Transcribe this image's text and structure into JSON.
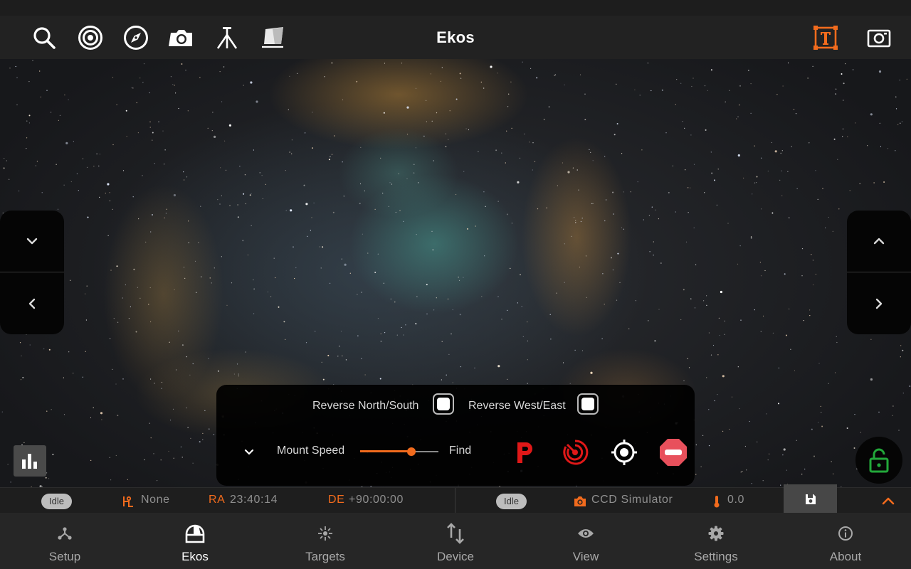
{
  "app": {
    "title": "Ekos"
  },
  "toolbar": {
    "left_icons": [
      "search-icon",
      "target-icon",
      "compass-icon",
      "camera-icon",
      "tripod-icon",
      "flat-panel-icon"
    ],
    "right_icons": [
      "text-frame-icon",
      "capture-frame-icon"
    ],
    "accent": "#f26b1d"
  },
  "mount_panel": {
    "reverse_ns_label": "Reverse North/South",
    "reverse_we_label": "Reverse West/East",
    "speed_label": "Mount Speed",
    "speed_value_label": "Find",
    "speed_fraction": 0.65,
    "actions": [
      "park-icon",
      "tracking-icon",
      "goto-target-icon",
      "stop-icon"
    ]
  },
  "status": {
    "mount_state": "Idle",
    "pier_side": "None",
    "ra_label": "RA",
    "ra_value": "23:40:14",
    "de_label": "DE",
    "de_value": "+90:00:00",
    "camera_state": "Idle",
    "camera_name": "CCD Simulator",
    "temperature": "0.0"
  },
  "nav": [
    {
      "label": "Setup",
      "icon": "setup-icon",
      "active": false
    },
    {
      "label": "Ekos",
      "icon": "ekos-dome-icon",
      "active": true
    },
    {
      "label": "Targets",
      "icon": "targets-icon",
      "active": false
    },
    {
      "label": "Device",
      "icon": "device-arrows-icon",
      "active": false
    },
    {
      "label": "View",
      "icon": "eye-icon",
      "active": false
    },
    {
      "label": "Settings",
      "icon": "gear-icon",
      "active": false
    },
    {
      "label": "About",
      "icon": "info-icon",
      "active": false
    }
  ],
  "colors": {
    "accent": "#f26b1d",
    "park": "#e01818",
    "lock": "#22a83a"
  }
}
